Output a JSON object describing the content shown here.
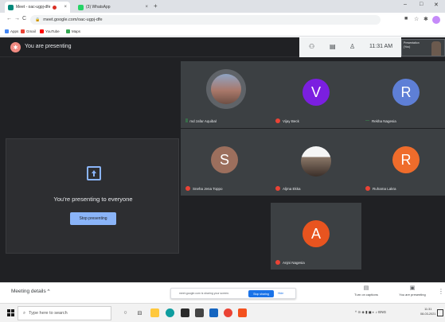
{
  "browser": {
    "tabs": [
      {
        "label": "Meet - oac-ugpj-dfe",
        "active": true,
        "close": "×"
      },
      {
        "label": "(3) WhatsApp",
        "active": false,
        "close": "×"
      }
    ],
    "new_tab": "+",
    "window_controls": {
      "minimize": "–",
      "maximize": "□",
      "close": "✕"
    },
    "url": "meet.google.com/oac-ugpj-dfe",
    "bookmarks": [
      {
        "label": "Apps",
        "color": "#4285f4"
      },
      {
        "label": "Gmail",
        "color": "#ea4335"
      },
      {
        "label": "YouTube",
        "color": "#ff0000"
      },
      {
        "label": "Maps",
        "color": "#34a853"
      }
    ]
  },
  "meet": {
    "presenting_title": "You are presenting",
    "clock": "11:31 AM",
    "preview_label": "Presentation (You)",
    "present_card": {
      "message": "You're presenting to everyone",
      "button": "Stop presenting"
    },
    "participants": [
      {
        "name": "md zafar Aquibal",
        "initial": "",
        "color": "",
        "photo": true,
        "status": "speaking"
      },
      {
        "name": "Vijay Beck",
        "initial": "V",
        "color": "#7b1fe0",
        "status": "muted"
      },
      {
        "name": "Rekha Nagesia",
        "initial": "R",
        "color": "#5e7fd6",
        "status": "active"
      },
      {
        "name": "Sneha Jena Toppo",
        "initial": "S",
        "color": "#9c6f5d",
        "status": "muted"
      },
      {
        "name": "Aljma Ekka",
        "initial": "",
        "color": "",
        "photo": true,
        "status": "muted"
      },
      {
        "name": "Ruhama Lakra",
        "initial": "R",
        "color": "#ef6c2b",
        "status": "muted"
      },
      {
        "name": "Anjni Nagesia",
        "initial": "A",
        "color": "#e8541f",
        "status": "muted"
      }
    ]
  },
  "bottom_bar": {
    "meeting_details": "Meeting details",
    "share_notice": "meet.google.com is sharing your screen.",
    "stop_sharing": "Stop sharing",
    "hide": "Hide",
    "captions": "Turn on captions",
    "presenting": "You are presenting"
  },
  "taskbar": {
    "search_placeholder": "Type here to search",
    "tray_lang": "ENG",
    "time": "11:31",
    "date": "08-03-2021"
  }
}
